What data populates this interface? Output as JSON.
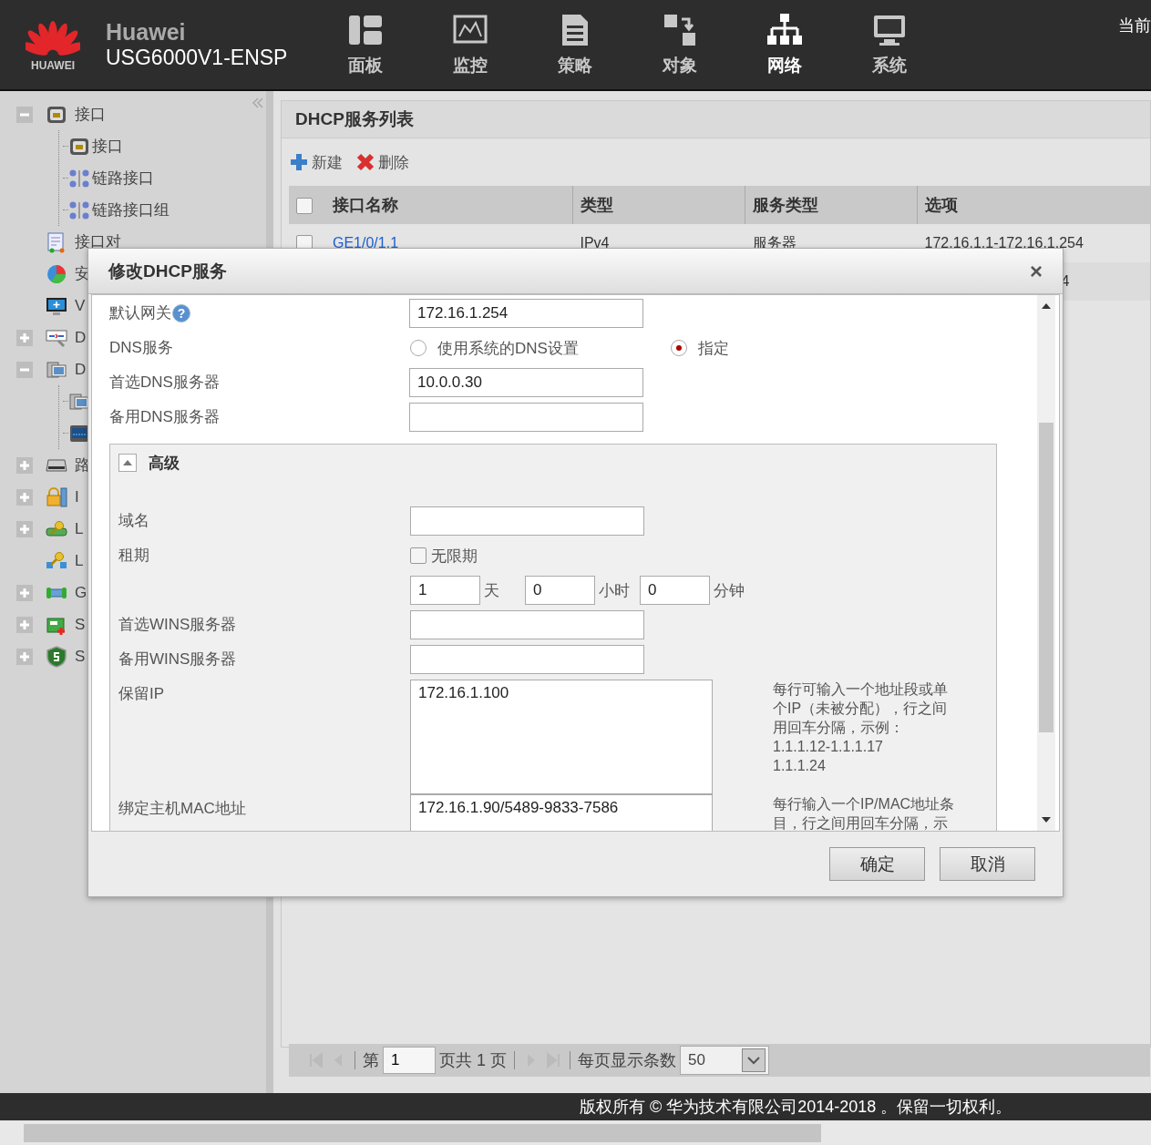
{
  "header": {
    "logo_text": "HUAWEI",
    "brand": "Huawei",
    "model": "USG6000V1-ENSP",
    "corner_text": "当前",
    "nav": [
      {
        "label": "面板",
        "selected": false
      },
      {
        "label": "监控",
        "selected": false
      },
      {
        "label": "策略",
        "selected": false
      },
      {
        "label": "对象",
        "selected": false
      },
      {
        "label": "网络",
        "selected": true
      },
      {
        "label": "系统",
        "selected": false
      }
    ]
  },
  "sidebar": {
    "items": [
      {
        "label": "接口",
        "expanded": true,
        "children": [
          {
            "label": "接口"
          },
          {
            "label": "链路接口"
          },
          {
            "label": "链路接口组"
          }
        ]
      },
      {
        "label": "接口对"
      },
      {
        "label": "安"
      },
      {
        "label": "V"
      },
      {
        "label": "D",
        "expanded": false
      },
      {
        "label": "D",
        "expanded": true,
        "children": [
          {
            "kind": "computer"
          },
          {
            "kind": "screen"
          }
        ]
      },
      {
        "label": "路",
        "expanded": false
      },
      {
        "label": "I",
        "expanded": false
      },
      {
        "label": "L",
        "expanded": false
      },
      {
        "label": "L"
      },
      {
        "label": "G",
        "expanded": false
      },
      {
        "label": "S",
        "expanded": false
      },
      {
        "label": "S",
        "expanded": false
      }
    ]
  },
  "panel": {
    "title": "DHCP服务列表",
    "toolbar": [
      {
        "label": "新建"
      },
      {
        "label": "删除"
      }
    ],
    "table": {
      "header_checked": false,
      "columns": [
        "接口名称",
        "类型",
        "服务类型",
        "选项"
      ],
      "rows": [
        {
          "checked": false,
          "name": "GE1/0/1.1",
          "type": "IPv4",
          "service": "服务器",
          "options": "172.16.1.1-172.16.1.254"
        },
        {
          "options_tail": "4"
        }
      ]
    },
    "pager": {
      "page_label": "第",
      "page": "1",
      "total": "页共 1 页",
      "size_label": "每页显示条数",
      "size": "50"
    }
  },
  "dialog": {
    "title": "修改DHCP服务",
    "close": "×",
    "fields": [
      {
        "kind": "text",
        "label": "默认网关",
        "help": "?",
        "value": "172.16.1.254"
      },
      {
        "kind": "radio",
        "label": "DNS服务",
        "options": [
          {
            "label": "使用系统的DNS设置",
            "selected": false
          },
          {
            "label": "指定",
            "selected": true
          }
        ]
      },
      {
        "kind": "text",
        "label": "首选DNS服务器",
        "value": "10.0.0.30"
      },
      {
        "kind": "text",
        "label": "备用DNS服务器"
      }
    ],
    "advanced": {
      "title": "高级",
      "expanded": true,
      "fields": [
        {
          "kind": "text",
          "label": "域名"
        },
        {
          "kind": "checkbox",
          "label": "租期",
          "option": "无限期",
          "checked": false
        },
        {
          "kind": "duration",
          "parts": [
            {
              "value": "1",
              "unit": "天"
            },
            {
              "value": "0",
              "unit": "小时"
            },
            {
              "value": "0",
              "unit": "分钟"
            }
          ]
        },
        {
          "kind": "text",
          "label": "首选WINS服务器"
        },
        {
          "kind": "text",
          "label": "备用WINS服务器"
        },
        {
          "kind": "textarea",
          "label": "保留IP",
          "value": "172.16.1.100",
          "hint": [
            "每行可输入一个地址段或单个IP（未被分配），行之间用回车分隔，示例：",
            "1.1.1.12-1.1.1.17",
            "1.1.1.24"
          ]
        },
        {
          "kind": "textarea",
          "label": "绑定主机MAC地址",
          "value": "172.16.1.90/5489-9833-7586",
          "hint": [
            "每行输入一个IP/MAC地址条目，行之间用回车分隔，示"
          ]
        }
      ]
    },
    "buttons": [
      "确定",
      "取消"
    ]
  },
  "footer": {
    "copyright": "版权所有 © 华为技术有限公司2014-2018 。保留一切权利。"
  }
}
